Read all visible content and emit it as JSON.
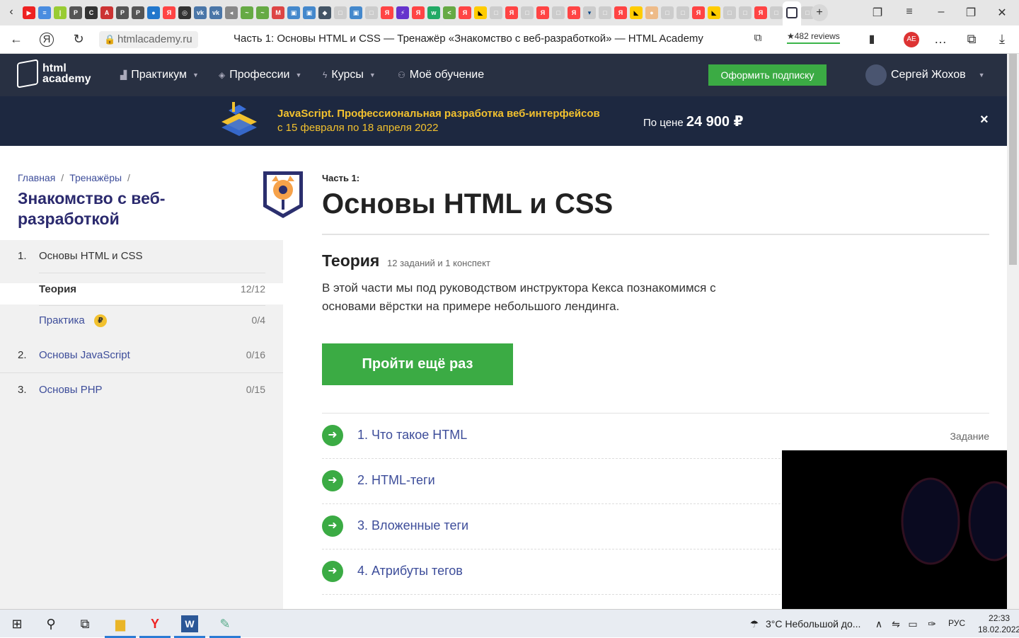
{
  "browser": {
    "url": "htmlacademy.ru",
    "page_title": "Часть 1: Основы HTML и CSS — Тренажёр «Знакомство с веб-разработкой» — HTML Academy",
    "reviews": "★482 reviews"
  },
  "site": {
    "logo_line1": "html",
    "logo_line2": "academy",
    "nav": [
      "Практикум",
      "Профессии",
      "Курсы",
      "Моё обучение"
    ],
    "subscribe_label": "Оформить подписку",
    "user_name": "Сергей Жохов"
  },
  "promo": {
    "title": "JavaScript. Профессиональная разработка веб-интерфейсов",
    "dates": "с 15 февраля по 18 апреля 2022",
    "price_label": "По цене ",
    "price": "24 900 ₽",
    "close": "×"
  },
  "sidebar": {
    "crumbs": [
      "Главная",
      "Тренажёры"
    ],
    "course_title": "Знакомство с веб-разработкой",
    "sections": [
      {
        "num": "1.",
        "label": "Основы HTML и CSS",
        "count": ""
      },
      {
        "num": "2.",
        "label": "Основы JavaScript",
        "count": "0/16"
      },
      {
        "num": "3.",
        "label": "Основы PHP",
        "count": "0/15"
      }
    ],
    "sub_items": [
      {
        "label": "Теория",
        "count": "12/12"
      },
      {
        "label": "Практика",
        "count": "0/4"
      }
    ],
    "coin": "₽"
  },
  "main": {
    "part_label": "Часть 1:",
    "part_title": "Основы HTML и CSS",
    "theory_title": "Теория",
    "theory_meta": "12 заданий и 1 конспект",
    "theory_desc": "В этой части мы под руководством инструктора Кекса познакомимся с основами вёрстки на примере небольшого лендинга.",
    "repeat_button": "Пройти ещё раз",
    "lessons": [
      {
        "title": "1. Что такое HTML",
        "type": "Задание"
      },
      {
        "title": "2. HTML-теги",
        "type": ""
      },
      {
        "title": "3. Вложенные теги",
        "type": ""
      },
      {
        "title": "4. Атрибуты тегов",
        "type": ""
      }
    ]
  },
  "taskbar": {
    "weather": "3°C  Небольшой до...",
    "lang": "РУС",
    "time": "22:33",
    "date": "18.02.2022"
  }
}
